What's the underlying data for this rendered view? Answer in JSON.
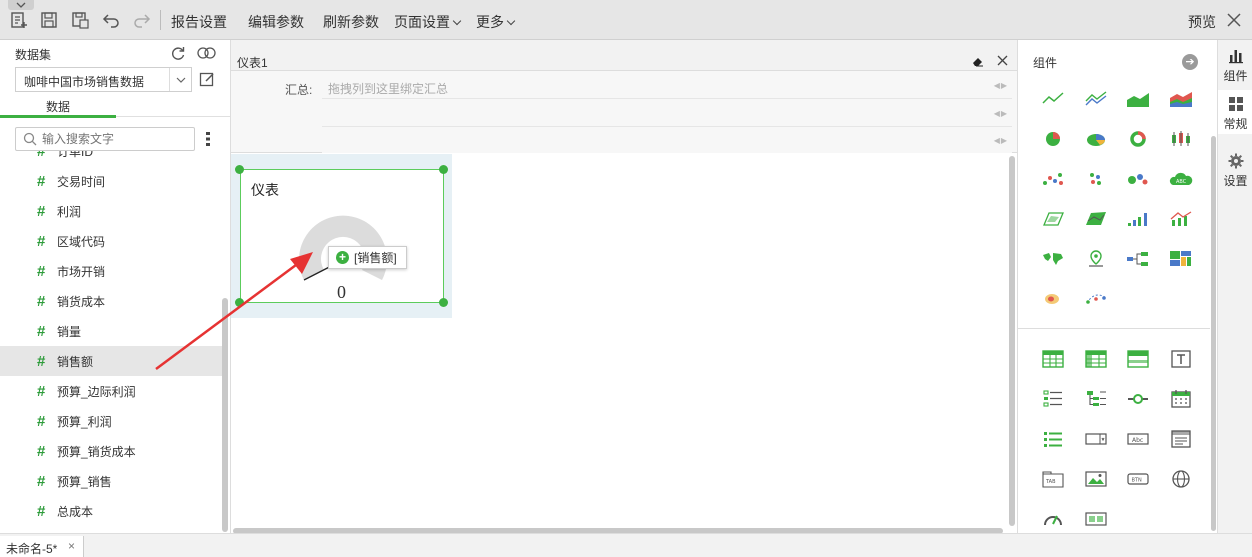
{
  "toolbar": {
    "menu_report_settings": "报告设置",
    "menu_edit_params": "编辑参数",
    "menu_refresh_params": "刷新参数",
    "menu_page_settings": "页面设置",
    "menu_more": "更多",
    "preview": "预览"
  },
  "left": {
    "dataset_label": "数据集",
    "dataset_selected": "咖啡中国市场销售数据",
    "tab_data": "数据",
    "search_placeholder": "输入搜索文字",
    "fields": [
      {
        "name": "订单ID"
      },
      {
        "name": "交易时间"
      },
      {
        "name": "利润"
      },
      {
        "name": "区域代码"
      },
      {
        "name": "市场开销"
      },
      {
        "name": "销货成本"
      },
      {
        "name": "销量"
      },
      {
        "name": "销售额",
        "selected": true
      },
      {
        "name": "预算_边际利润"
      },
      {
        "name": "预算_利润"
      },
      {
        "name": "预算_销货成本"
      },
      {
        "name": "预算_销售"
      },
      {
        "name": "总成本"
      }
    ]
  },
  "center": {
    "tab_title": "仪表1",
    "summary_label": "汇总:",
    "summary_placeholder": "拖拽列到这里绑定汇总",
    "widget_title": "仪表",
    "gauge_value": "0",
    "drag_tip": "[销售额]"
  },
  "right": {
    "title": "组件",
    "sidebar": [
      {
        "label": "组件",
        "icon": "bar-chart-icon"
      },
      {
        "label": "常规",
        "icon": "grid-icon"
      },
      {
        "label": "设置",
        "icon": "gear-icon"
      }
    ]
  },
  "bottom": {
    "doc_tab": "未命名-5*"
  },
  "colors": {
    "accent": "#3cb041",
    "arrow": "#e63333"
  }
}
